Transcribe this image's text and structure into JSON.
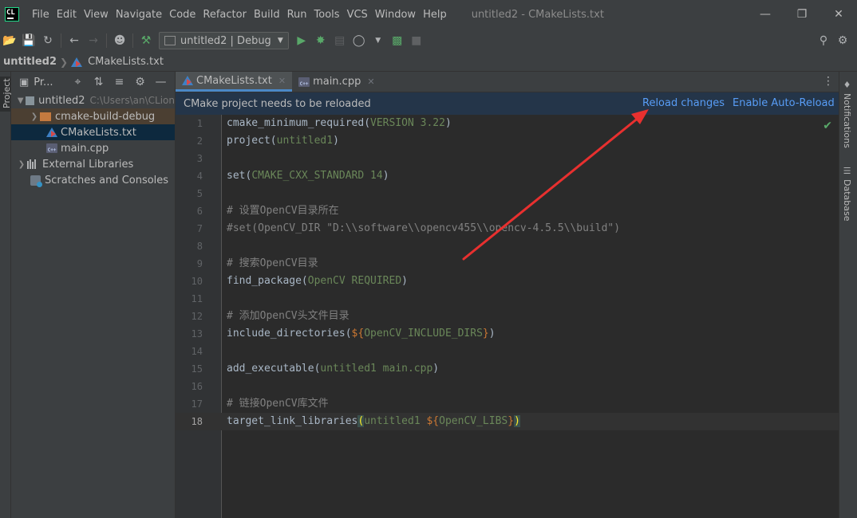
{
  "app": {
    "logo_text": "CL",
    "window_title": "untitled2 - CMakeLists.txt"
  },
  "menu": [
    "File",
    "Edit",
    "View",
    "Navigate",
    "Code",
    "Refactor",
    "Build",
    "Run",
    "Tools",
    "VCS",
    "Window",
    "Help"
  ],
  "toolbar": {
    "run_config": "untitled2 | Debug"
  },
  "breadcrumb": {
    "project": "untitled2",
    "file": "CMakeLists.txt"
  },
  "left_strip": {
    "label": "Project"
  },
  "project_panel": {
    "title": "Pr...",
    "tree": [
      {
        "label": "untitled2",
        "hint": "C:\\Users\\an\\CLion"
      },
      {
        "label": "cmake-build-debug"
      },
      {
        "label": "CMakeLists.txt"
      },
      {
        "label": "main.cpp"
      },
      {
        "label": "External Libraries"
      },
      {
        "label": "Scratches and Consoles"
      }
    ]
  },
  "tabs": [
    {
      "label": "CMakeLists.txt",
      "active": true
    },
    {
      "label": "main.cpp",
      "active": false
    }
  ],
  "notice": {
    "message": "CMake project needs to be reloaded",
    "reload": "Reload changes",
    "auto_reload": "Enable Auto-Reload"
  },
  "code": {
    "line_numbers": [
      "1",
      "2",
      "3",
      "4",
      "5",
      "6",
      "7",
      "8",
      "9",
      "10",
      "11",
      "12",
      "13",
      "14",
      "15",
      "16",
      "17",
      "18"
    ],
    "current_line": 18,
    "l1_cmd": "cmake_minimum_required",
    "l1_arg": "VERSION 3.22",
    "l2_cmd": "project",
    "l2_arg": "untitled1",
    "l4_cmd": "set",
    "l4_arg": "CMAKE_CXX_STANDARD 14",
    "l6": "# 设置OpenCV目录所在",
    "l7": "#set(OpenCV_DIR \"D:\\\\software\\\\opencv455\\\\opencv-4.5.5\\\\build\")",
    "l9": "# 搜索OpenCV目录",
    "l10_cmd": "find_package",
    "l10_arg": "OpenCV REQUIRED",
    "l12": "# 添加OpenCV头文件目录",
    "l13_cmd": "include_directories",
    "l13_var": "OpenCV_INCLUDE_DIRS",
    "l15_cmd": "add_executable",
    "l15_arg": "untitled1 main.cpp",
    "l17": "# 链接OpenCV库文件",
    "l18_cmd": "target_link_libraries",
    "l18_arg": "untitled1",
    "l18_var": "OpenCV_LIBS"
  },
  "right_strip": {
    "notifications": "Notifications",
    "database": "Database"
  },
  "colors": {
    "annotation_arrow": "#e8302f",
    "link": "#589df6",
    "notice_bg": "#243549"
  }
}
